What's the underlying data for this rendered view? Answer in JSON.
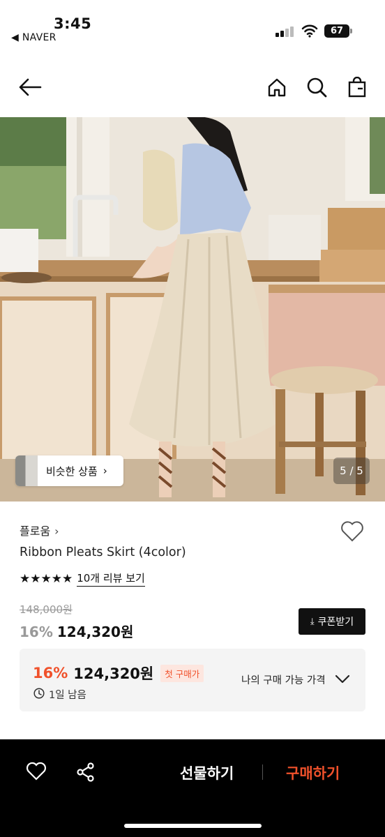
{
  "status_bar": {
    "time": "3:45",
    "back_app": "◀ NAVER",
    "battery": "67"
  },
  "nav": {
    "back_icon": "arrow-left-icon",
    "home_icon": "home-icon",
    "search_icon": "search-icon",
    "bag_icon": "shopping-bag-icon"
  },
  "gallery": {
    "similar_label": "비슷한 상품",
    "similar_chevron": "›",
    "counter": "5 / 5"
  },
  "product": {
    "brand": "플로움",
    "brand_chevron": "›",
    "name": "Ribbon Pleats Skirt (4color)",
    "stars": "★★★★★",
    "review_link": "10개 리뷰 보기",
    "original_price": "148,000원",
    "discount": "16%",
    "price": "124,320원",
    "coupon_button": "쿠폰받기"
  },
  "price_box": {
    "discount": "16%",
    "price": "124,320원",
    "badge": "첫 구매가",
    "remaining": "1일 남음",
    "my_price_label": "나의 구매 가능 가격"
  },
  "bottom_bar": {
    "gift_label": "선물하기",
    "buy_label": "구매하기"
  },
  "colors": {
    "accent": "#f0512b",
    "bottom_bar_bg": "#000000",
    "price_box_bg": "#f4f4f4"
  }
}
